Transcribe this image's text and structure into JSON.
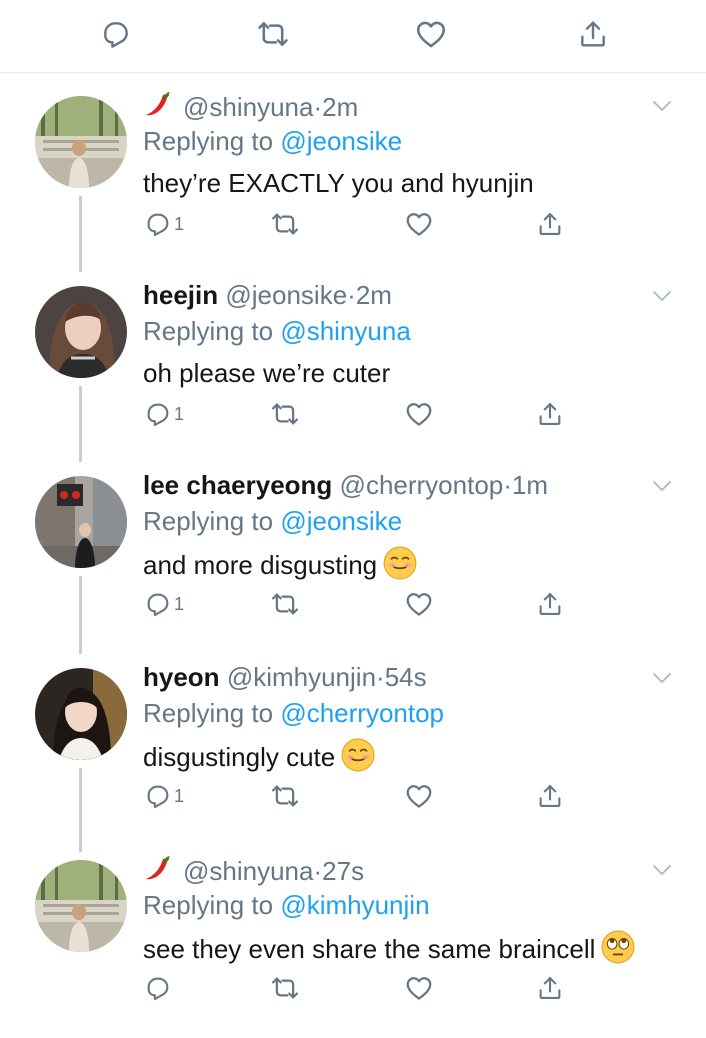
{
  "tweets": [
    {
      "name": "",
      "handle": "@shinyuna",
      "time": "2m",
      "reply_prefix": "Replying to",
      "reply_to": "@jeonsike",
      "text": "they’re EXACTLY you and hyunjin",
      "reply_count": "1",
      "name_emoji": "chili-pepper",
      "text_emoji": null
    },
    {
      "name": "heejin",
      "handle": "@jeonsike",
      "time": "2m",
      "reply_prefix": "Replying to",
      "reply_to": "@shinyuna",
      "text": "oh please we’re cuter",
      "reply_count": "1",
      "name_emoji": null,
      "text_emoji": null
    },
    {
      "name": "lee chaeryeong",
      "handle": "@cherryontop",
      "time": "1m",
      "reply_prefix": "Replying to",
      "reply_to": "@jeonsike",
      "text": "and more disgusting",
      "reply_count": "1",
      "name_emoji": null,
      "text_emoji": "smiling-face"
    },
    {
      "name": "hyeon",
      "handle": "@kimhyunjin",
      "time": "54s",
      "reply_prefix": "Replying to",
      "reply_to": "@cherryontop",
      "text": "disgustingly cute",
      "reply_count": "1",
      "name_emoji": null,
      "text_emoji": "smiling-face"
    },
    {
      "name": "",
      "handle": "@shinyuna",
      "time": "27s",
      "reply_prefix": "Replying to",
      "reply_to": "@kimhyunjin",
      "text": "see they even share the same braincell",
      "reply_count": "",
      "name_emoji": "chili-pepper",
      "text_emoji": "eye-roll-face"
    }
  ],
  "separator": "·",
  "colors": {
    "link": "#1da1f2",
    "muted": "#657786",
    "text": "#14171a",
    "icon": "#657786",
    "thread_line": "#c4cfd6"
  }
}
